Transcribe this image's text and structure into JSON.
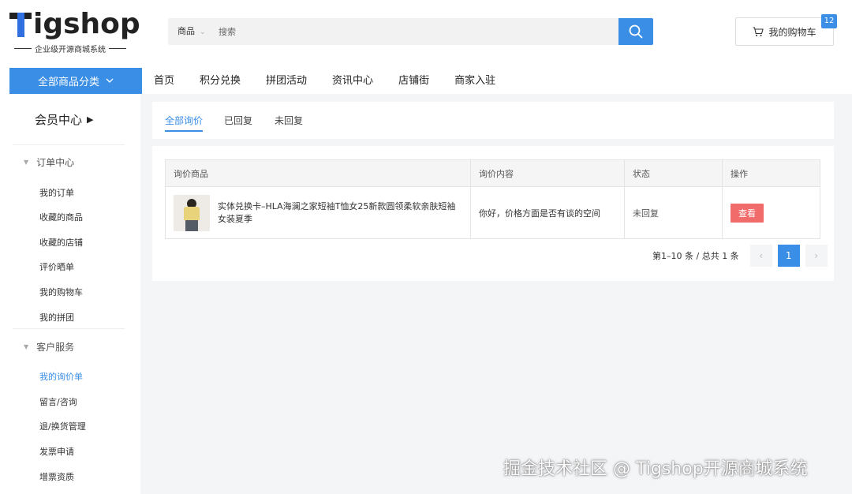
{
  "logo": {
    "brand": "igshop",
    "tagline": "企业级开源商城系统"
  },
  "search": {
    "category": "商品",
    "placeholder": "搜索"
  },
  "cart": {
    "label": "我的购物车",
    "count": "12"
  },
  "nav": {
    "category_button": "全部商品分类",
    "items": [
      "首页",
      "积分兑换",
      "拼团活动",
      "资讯中心",
      "店铺街",
      "商家入驻"
    ]
  },
  "sidebar": {
    "member_center": "会员中心",
    "groups": [
      {
        "title": "订单中心",
        "links": [
          "我的订单",
          "收藏的商品",
          "收藏的店铺",
          "评价晒单",
          "我的购物车",
          "我的拼团"
        ]
      },
      {
        "title": "客户服务",
        "links": [
          "我的询价单",
          "留言/咨询",
          "退/换货管理",
          "发票申请",
          "增票资质"
        ]
      }
    ],
    "active_link": "我的询价单"
  },
  "tabs": [
    "全部询价",
    "已回复",
    "未回复"
  ],
  "table": {
    "headers": [
      "询价商品",
      "询价内容",
      "状态",
      "操作"
    ],
    "rows": [
      {
        "goods": "实体兑换卡–HLA海澜之家短袖T恤女25新款圆领柔软亲肤短袖女装夏季",
        "content": "你好，价格方面是否有谈的空间",
        "status": "未回复",
        "action": "查看"
      }
    ]
  },
  "pagination": {
    "info": "第1–10 条 / 总共 1 条",
    "current": "1",
    "prev": "‹",
    "next": "›"
  },
  "watermark": "掘金技术社区 @ Tigshop开源商城系统",
  "colors": {
    "primary": "#3a8ee6",
    "danger": "#f26b6b"
  }
}
